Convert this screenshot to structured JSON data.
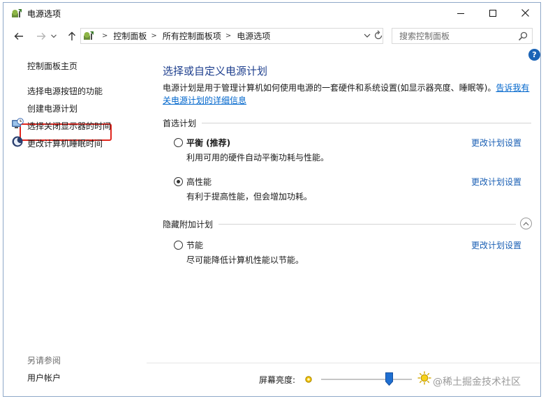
{
  "window": {
    "title": "电源选项"
  },
  "address": {
    "breadcrumbs": [
      "控制面板",
      "所有控制面板项",
      "电源选项"
    ],
    "search_placeholder": "搜索控制面板"
  },
  "sidebar": {
    "home": "控制面板主页",
    "items": [
      {
        "label": "选择电源按钮的功能",
        "icon": null,
        "highlighted": true
      },
      {
        "label": "创建电源计划",
        "icon": null,
        "highlighted": false
      },
      {
        "label": "选择关闭显示器的时间",
        "icon": "monitor-clock-icon",
        "highlighted": false
      },
      {
        "label": "更改计算机睡眠时间",
        "icon": "moon-sleep-icon",
        "highlighted": false
      }
    ],
    "see_also": "另请参阅",
    "see_also_items": [
      "用户帐户"
    ]
  },
  "main": {
    "title": "选择或自定义电源计划",
    "description": "电源计划是用于管理计算机如何使用电源的一套硬件和系统设置(如显示器亮度、睡眠等)。",
    "description_link": "告诉我有关电源计划的详细信息",
    "preferred_section": "首选计划",
    "hidden_section": "隐藏附加计划",
    "plans": [
      {
        "name": "平衡 (推荐)",
        "bold": true,
        "selected": false,
        "description": "利用可用的硬件自动平衡功耗与性能。",
        "link": "更改计划设置"
      },
      {
        "name": "高性能",
        "bold": false,
        "selected": true,
        "description": "有利于提高性能，但会增加功耗。",
        "link": "更改计划设置"
      },
      {
        "name": "节能",
        "bold": false,
        "selected": false,
        "description": "尽可能降低计算机性能以节能。",
        "link": "更改计划设置"
      }
    ]
  },
  "bottom": {
    "brightness_label": "屏幕亮度:",
    "brightness_level": 0.75
  },
  "watermark": "@稀土掘金技术社区",
  "colors": {
    "link": "#1a5fb4",
    "title": "#1e3f8e",
    "highlight_border": "#e0261e",
    "help": "#1c64b6"
  }
}
